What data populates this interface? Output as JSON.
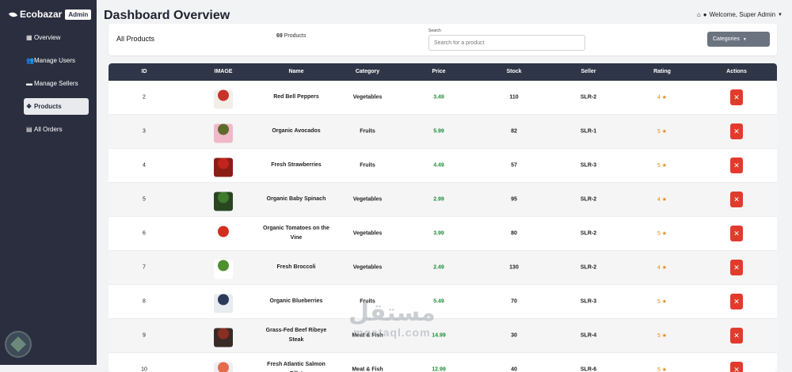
{
  "sidebar": {
    "brand": "Ecobazar",
    "badge": "Admin",
    "items": [
      {
        "icon": "grid-icon",
        "glyph": "▦",
        "label": "Overview",
        "active": false
      },
      {
        "icon": "users-icon",
        "glyph": "👥",
        "label": "Manage Users",
        "active": false
      },
      {
        "icon": "store-icon",
        "glyph": "▬",
        "label": "Manage Sellers",
        "active": false
      },
      {
        "icon": "boxes-icon",
        "glyph": "❖",
        "label": "Products",
        "active": true
      },
      {
        "icon": "file-icon",
        "glyph": "▤",
        "label": "All Orders",
        "active": false
      }
    ]
  },
  "header": {
    "title": "Dashboard Overview",
    "welcome": "Welcome, Super Admin"
  },
  "filter": {
    "title": "All Products",
    "count": "69",
    "count_suffix": "Products",
    "search_label": "Search",
    "search_placeholder": "Search for a product",
    "categories_label": "Categories"
  },
  "table": {
    "columns": [
      "ID",
      "IMAGE",
      "Name",
      "Category",
      "Price",
      "Stock",
      "Seller",
      "Rating",
      "Actions"
    ],
    "rows": [
      {
        "id": "2",
        "name": "Red Bell Peppers",
        "category": "Vegetables",
        "price": "3.49",
        "stock": "110",
        "seller": "SLR-2",
        "rating": "4 ★",
        "img": "#c9342a",
        "img_bg": "#f3eee8"
      },
      {
        "id": "3",
        "name": "Organic Avocados",
        "category": "Fruits",
        "price": "5.99",
        "stock": "82",
        "seller": "SLR-1",
        "rating": "5 ★",
        "img": "#5f6b2a",
        "img_bg": "#f2b7c9"
      },
      {
        "id": "4",
        "name": "Fresh Strawberries",
        "category": "Fruits",
        "price": "4.49",
        "stock": "57",
        "seller": "SLR-3",
        "rating": "5 ★",
        "img": "#c0241c",
        "img_bg": "#8a1d16"
      },
      {
        "id": "5",
        "name": "Organic Baby Spinach",
        "category": "Vegetables",
        "price": "2.99",
        "stock": "95",
        "seller": "SLR-2",
        "rating": "4 ★",
        "img": "#3f7a2e",
        "img_bg": "#28461f"
      },
      {
        "id": "6",
        "name": "Organic Tomatoes on the Vine",
        "category": "Vegetables",
        "price": "3.99",
        "stock": "80",
        "seller": "SLR-2",
        "rating": "5 ★",
        "img": "#d12f1f",
        "img_bg": "#ffffff"
      },
      {
        "id": "7",
        "name": "Fresh Broccoli",
        "category": "Vegetables",
        "price": "2.49",
        "stock": "130",
        "seller": "SLR-2",
        "rating": "4 ★",
        "img": "#4e8f2e",
        "img_bg": "#ffffff"
      },
      {
        "id": "8",
        "name": "Organic Blueberries",
        "category": "Fruits",
        "price": "5.49",
        "stock": "70",
        "seller": "SLR-3",
        "rating": "5 ★",
        "img": "#2c3a5a",
        "img_bg": "#e8ebf0"
      },
      {
        "id": "9",
        "name": "Grass-Fed Beef Ribeye Steak",
        "category": "Meat & Fish",
        "price": "14.99",
        "stock": "30",
        "seller": "SLR-4",
        "rating": "5 ★",
        "img": "#8a2e22",
        "img_bg": "#3a2a26"
      },
      {
        "id": "10",
        "name": "Fresh Atlantic Salmon Fillet",
        "category": "Meat & Fish",
        "price": "12.99",
        "stock": "40",
        "seller": "SLR-6",
        "rating": "5 ★",
        "img": "#e56b4e",
        "img_bg": "#eeeeee"
      }
    ],
    "delete_glyph": "✕"
  },
  "colors": {
    "sidebar_bg": "#2b2e3e",
    "table_header_bg": "#2f3648",
    "price_green": "#1f8f3a",
    "rating_orange": "#e08a12",
    "delete_red": "#e23b2e",
    "categories_btn": "#6b7380"
  },
  "watermark": {
    "arabic": "مستقل",
    "latin": "mostaql.com"
  }
}
